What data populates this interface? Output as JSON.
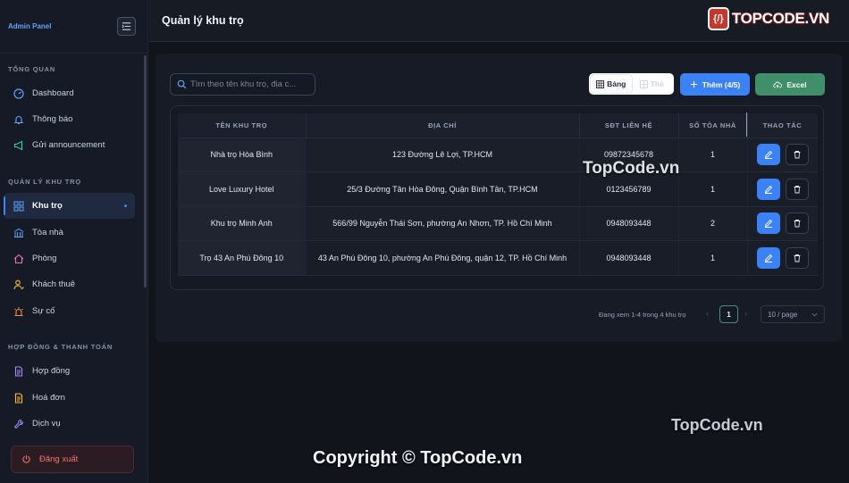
{
  "sidebar": {
    "title": "Admin Panel",
    "sections": [
      {
        "label": "TỔNG QUAN",
        "items": [
          {
            "label": "Dashboard",
            "icon": "dashboard-icon"
          },
          {
            "label": "Thông báo",
            "icon": "bell-icon"
          },
          {
            "label": "Gửi announcement",
            "icon": "megaphone-icon"
          }
        ]
      },
      {
        "label": "QUẢN LÝ KHU TRỌ",
        "items": [
          {
            "label": "Khu trọ",
            "icon": "grid-icon",
            "active": true
          },
          {
            "label": "Tòa nhà",
            "icon": "building-icon"
          },
          {
            "label": "Phòng",
            "icon": "home-icon"
          },
          {
            "label": "Khách thuê",
            "icon": "user-icon"
          },
          {
            "label": "Sự cố",
            "icon": "alarm-icon"
          }
        ]
      },
      {
        "label": "HỢP ĐỒNG & THANH TOÁN",
        "items": [
          {
            "label": "Hợp đồng",
            "icon": "document-icon"
          },
          {
            "label": "Hoá đơn",
            "icon": "invoice-icon"
          },
          {
            "label": "Dịch vụ",
            "icon": "wrench-icon"
          }
        ]
      }
    ],
    "logout_label": "Đăng xuất"
  },
  "header": {
    "title": "Quản lý khu trọ",
    "brand_badge": "{/}",
    "brand_text": "TOPCODE.VN"
  },
  "toolbar": {
    "search_placeholder": "Tìm theo tên khu trọ, địa c...",
    "view_table_label": "Bảng",
    "view_card_label": "Thẻ",
    "add_label": "Thêm (4/5)",
    "excel_label": "Excel"
  },
  "table": {
    "columns": [
      "TÊN KHU TRỌ",
      "ĐỊA CHỈ",
      "SĐT LIÊN HỆ",
      "SỐ TÒA NHÀ",
      "THAO TÁC"
    ],
    "rows": [
      {
        "name": "Nhà trọ Hòa Bình",
        "address": "123 Đường Lê Lợi, TP.HCM",
        "phone": "09872345678",
        "buildings": "1"
      },
      {
        "name": "Love Luxury Hotel",
        "address": "25/3 Đường Tân Hòa Đông, Quận Bình Tân, TP.HCM",
        "phone": "0123456789",
        "buildings": "1"
      },
      {
        "name": "Khu trọ Minh Anh",
        "address": "566/99 Nguyễn Thái Sơn, phường An Nhơn, TP. Hồ Chí Minh",
        "phone": "0948093448",
        "buildings": "2"
      },
      {
        "name": "Trọ 43 An Phú Đông 10",
        "address": "43 An Phú Đông 10, phường An Phú Đông, quận 12, TP. Hồ Chí Minh",
        "phone": "0948093448",
        "buildings": "1"
      }
    ]
  },
  "pagination": {
    "summary": "Đang xem 1-4 trong 4 khu trọ",
    "current_page": "1",
    "page_size": "10 / page"
  },
  "watermarks": {
    "overlay1": "TopCode.vn",
    "overlay2": "TopCode.vn",
    "copyright": "Copyright © TopCode.vn"
  },
  "colors": {
    "accent": "#3b82f6",
    "excel": "#3f8f6a",
    "danger": "#f87171",
    "background": "#11141b"
  }
}
